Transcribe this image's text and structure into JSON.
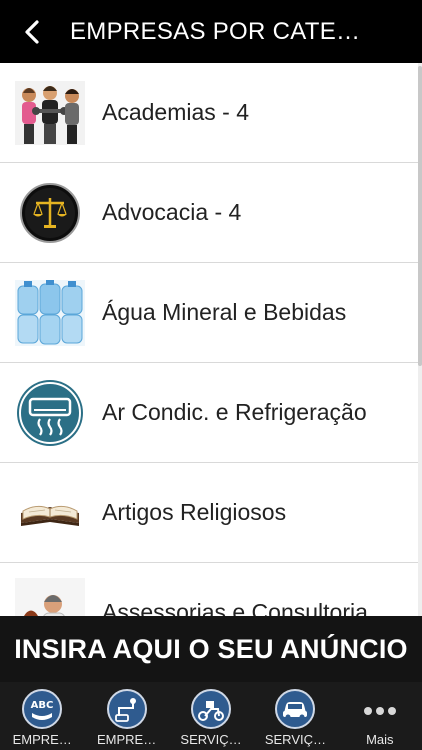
{
  "header": {
    "title": "EMPRESAS POR CATE…",
    "back_icon": "chevron-left-icon"
  },
  "categories": [
    {
      "label": "Academias - 4",
      "icon": "fitness-people-icon"
    },
    {
      "label": "Advocacia - 4",
      "icon": "scales-of-justice-icon"
    },
    {
      "label": "Água Mineral e Bebidas",
      "icon": "water-jugs-icon"
    },
    {
      "label": "Ar Condic. e Refrigeração",
      "icon": "air-conditioner-icon"
    },
    {
      "label": "Artigos Religiosos",
      "icon": "bible-book-icon"
    },
    {
      "label": "Assessorias e Consultoria",
      "icon": "business-people-icon"
    }
  ],
  "ad_banner": {
    "text": "INSIRA AQUI O SEU ANÚNCIO"
  },
  "tabbar": {
    "tabs": [
      {
        "label": "EMPRE…",
        "icon": "abc-directory-icon"
      },
      {
        "label": "EMPRE…",
        "icon": "map-route-icon"
      },
      {
        "label": "SERVIÇ…",
        "icon": "motorbike-delivery-icon"
      },
      {
        "label": "SERVIÇ…",
        "icon": "car-icon"
      },
      {
        "label": "Mais",
        "icon": "more-dots-icon"
      }
    ]
  },
  "colors": {
    "header_bg": "#000000",
    "tabbar_bg": "#1b1b1b",
    "tab_icon_blue": "#2f5b8f",
    "separator": "#d9d9d9"
  }
}
